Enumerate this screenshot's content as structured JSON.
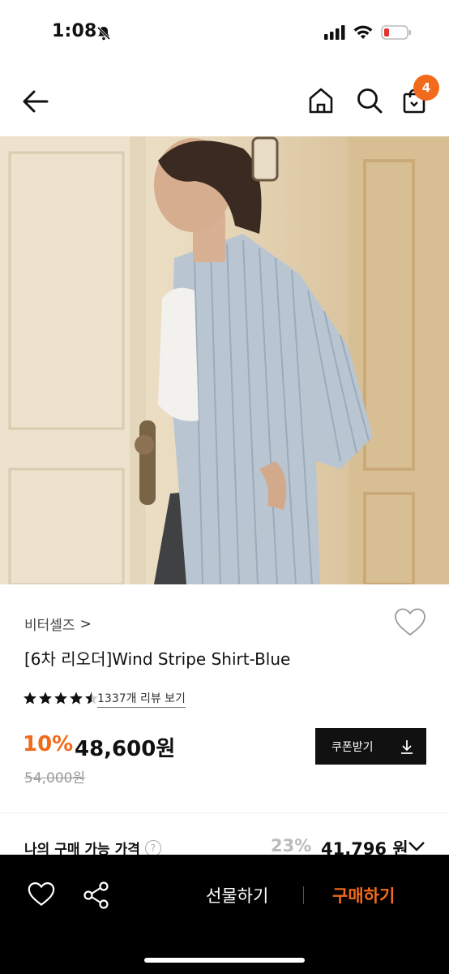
{
  "status_bar": {
    "time": "1:08",
    "icons": [
      "bell-slash-icon",
      "signal-icon",
      "wifi-icon",
      "battery-icon"
    ]
  },
  "nav": {
    "back_icon": "arrow-left-icon",
    "home_icon": "home-icon",
    "search_icon": "search-icon",
    "cart_icon": "shopping-bag-icon",
    "cart_count": "4",
    "badge_color": "#f26a1b"
  },
  "product": {
    "brand": "비터셀즈",
    "brand_chevron": ">",
    "title": "[6차 리오더]Wind Stripe Shirt-Blue",
    "rating": 4.5,
    "review_link": "1337개 리뷰 보기",
    "discount": "10%",
    "price": "48,600원",
    "original_price": "54,000원",
    "coupon_label": "쿠폰받기"
  },
  "my_price": {
    "label": "나의 구매 가능 가격",
    "help": "?",
    "discount": "23%",
    "price": "41,796 원"
  },
  "bottom_bar": {
    "gift_label": "선물하기",
    "buy_label": "구매하기",
    "accent": "#f26a1b"
  }
}
